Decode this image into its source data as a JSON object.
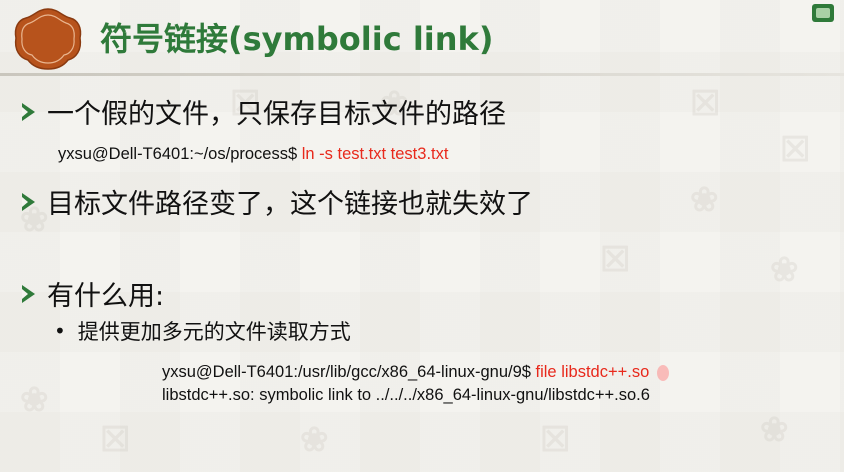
{
  "slide": {
    "title": "符号链接(symbolic link)",
    "bullets": [
      "一个假的文件，只保存目标文件的路径",
      "目标文件路径变了，这个链接也就失效了",
      "有什么用:"
    ],
    "sub_bullet": "提供更加多元的文件读取方式",
    "cmd1": {
      "prompt": "yxsu@Dell-T6401:~/os/process$ ",
      "command": "ln -s test.txt test3.txt"
    },
    "cmd2": {
      "prompt": "yxsu@Dell-T6401:/usr/lib/gcc/x86_64-linux-gnu/9$ ",
      "command": "file libstdc++.so",
      "output": "libstdc++.so: symbolic link to ../../../x86_64-linux-gnu/libstdc++.so.6"
    }
  },
  "colors": {
    "title": "#2f7a3a",
    "command": "#e8291c",
    "emblem": "#b7531c",
    "background": "#f4f3ef"
  },
  "icons": {
    "title_emblem": "decorative-emblem-icon",
    "bullet": "arrow-bullet-icon"
  }
}
